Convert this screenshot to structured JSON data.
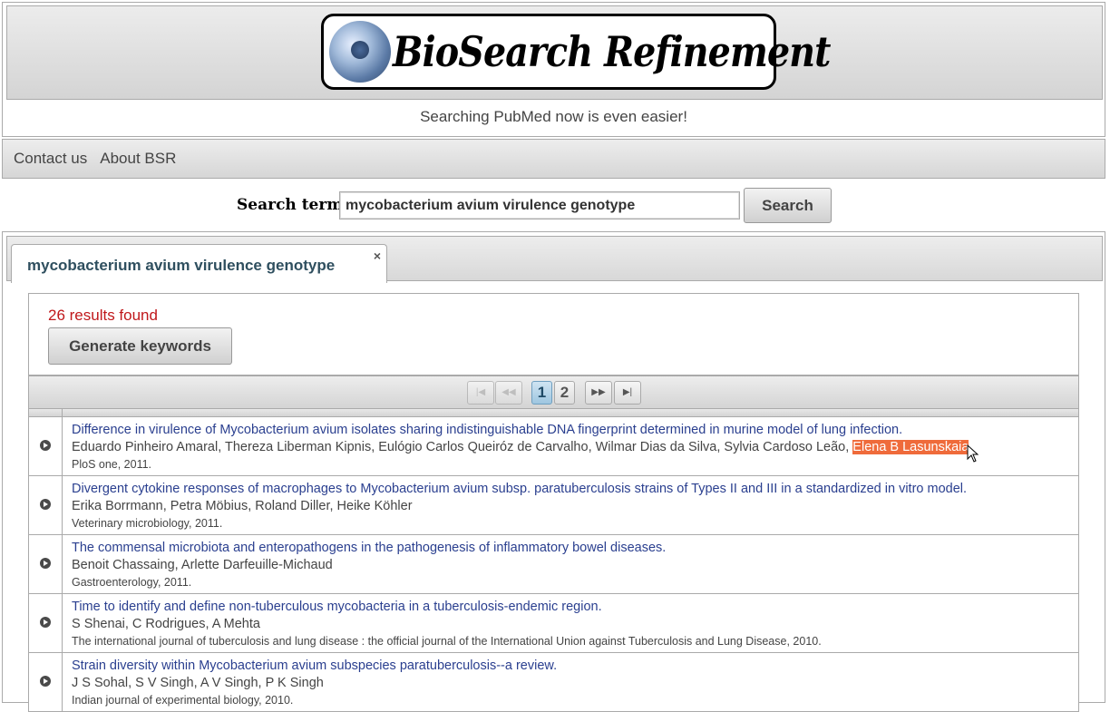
{
  "header": {
    "logo_text": "BioSearch Refinement",
    "tagline": "Searching PubMed now is even easier!"
  },
  "nav": {
    "items": [
      {
        "label": "Contact us"
      },
      {
        "label": "About BSR"
      }
    ]
  },
  "search": {
    "label": "Search term",
    "value": "mycobacterium avium virulence genotype",
    "button": "Search"
  },
  "tab": {
    "label": "mycobacterium avium virulence genotype",
    "close": "×"
  },
  "results": {
    "count_text": "26 results found",
    "generate_button": "Generate keywords"
  },
  "pager": {
    "first": "|◀",
    "prev": "◀◀",
    "pages": [
      "1",
      "2"
    ],
    "current_page": "1",
    "next": "▶▶",
    "last": "▶|"
  },
  "rows": [
    {
      "title": "Difference in virulence of Mycobacterium avium isolates sharing indistinguishable DNA fingerprint determined in murine model of lung infection.",
      "authors": "Eduardo Pinheiro Amaral, Thereza Liberman Kipnis, Eulógio Carlos Queiróz de Carvalho, Wilmar Dias da Silva, Sylvia Cardoso Leão, ",
      "authors_highlight": "Elena B Lasunskaia",
      "journal": "PloS one, 2011."
    },
    {
      "title": "Divergent cytokine responses of macrophages to Mycobacterium avium subsp. paratuberculosis strains of Types II and III in a standardized in vitro model.",
      "authors": "Erika Borrmann, Petra Möbius, Roland Diller, Heike Köhler",
      "journal": "Veterinary microbiology, 2011."
    },
    {
      "title": "The commensal microbiota and enteropathogens in the pathogenesis of inflammatory bowel diseases.",
      "authors": "Benoit Chassaing, Arlette Darfeuille-Michaud",
      "journal": "Gastroenterology, 2011."
    },
    {
      "title": "Time to identify and define non-tuberculous mycobacteria in a tuberculosis-endemic region.",
      "authors": "S Shenai, C Rodrigues, A Mehta",
      "journal": "The international journal of tuberculosis and lung disease : the official journal of the International Union against Tuberculosis and Lung Disease, 2010."
    },
    {
      "title": "Strain diversity within Mycobacterium avium subspecies paratuberculosis--a review.",
      "authors": "J S Sohal, S V Singh, A V Singh, P K Singh",
      "journal": "Indian journal of experimental biology, 2010."
    }
  ]
}
